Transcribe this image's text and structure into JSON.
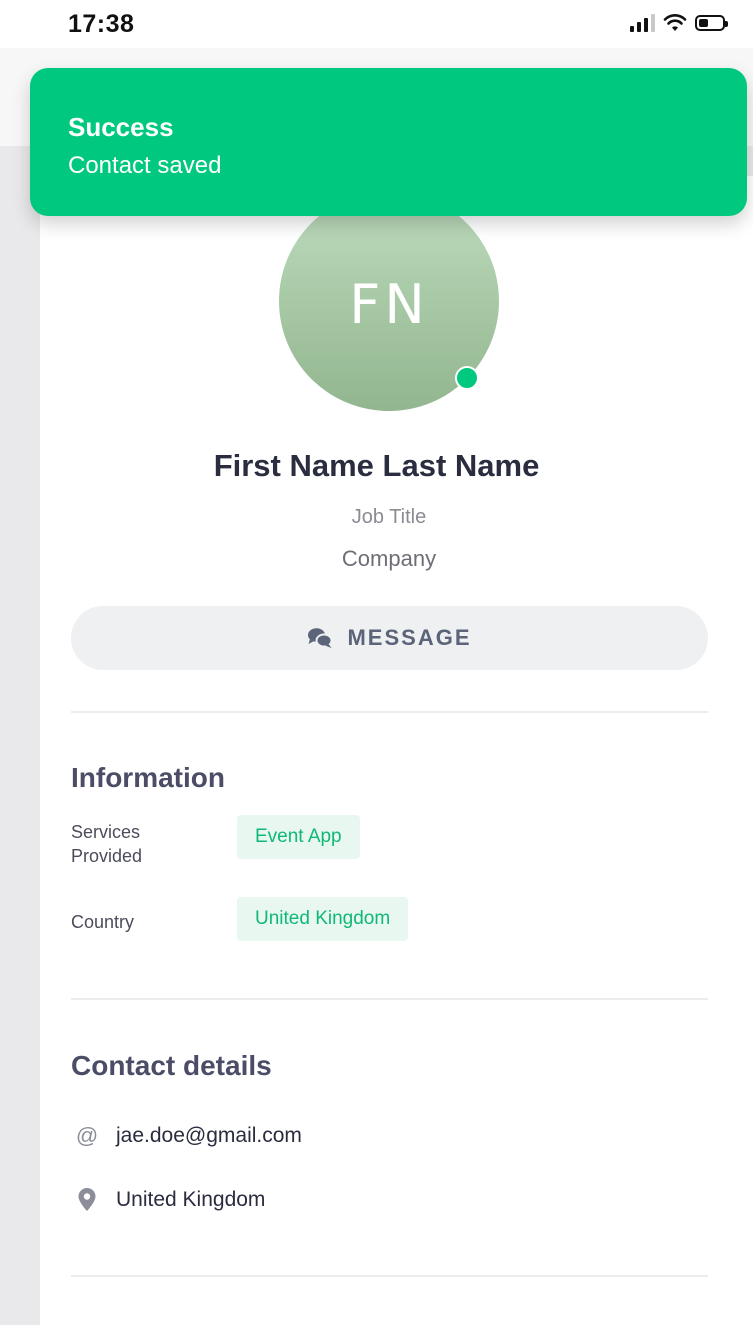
{
  "status_bar": {
    "time": "17:38"
  },
  "toast": {
    "title": "Success",
    "message": "Contact saved",
    "color": "#00c97f"
  },
  "profile": {
    "initials": "FN",
    "name": "First Name Last Name",
    "job_title": "Job Title",
    "company": "Company",
    "online": true
  },
  "actions": {
    "message_label": "MESSAGE"
  },
  "information": {
    "title": "Information",
    "rows": [
      {
        "label": "Services Provided",
        "value": "Event App"
      },
      {
        "label": "Country",
        "value": "United Kingdom"
      }
    ]
  },
  "contact_details": {
    "title": "Contact details",
    "items": [
      {
        "icon": "at-icon",
        "value": "jae.doe@gmail.com"
      },
      {
        "icon": "location-pin-icon",
        "value": "United Kingdom"
      }
    ]
  },
  "colors": {
    "accent": "#00c97f",
    "tag_bg": "#e8f8f0",
    "tag_text": "#10b877"
  }
}
